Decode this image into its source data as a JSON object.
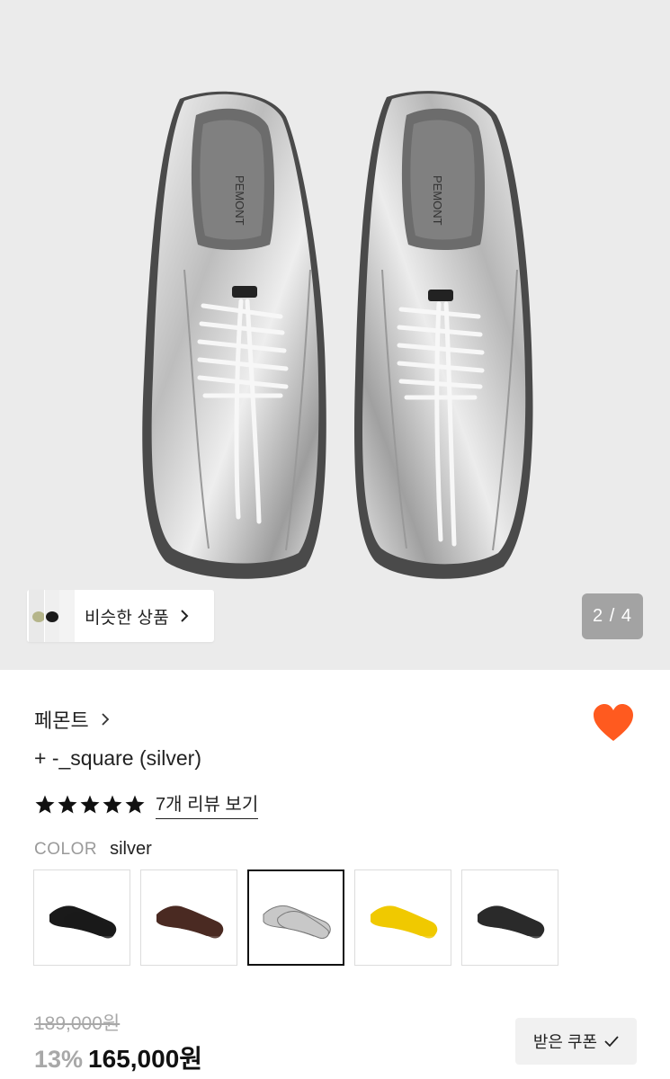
{
  "gallery": {
    "counter": "2 / 4",
    "similar_label": "비슷한 상품",
    "shoe_brand_mark": "PEMONT"
  },
  "product": {
    "brand": "페몬트",
    "name": "+ -_square (silver)",
    "rating_stars": 5,
    "review_link": "7개 리뷰 보기",
    "liked": true,
    "heart_color": "#ff5a1f"
  },
  "color": {
    "label": "COLOR",
    "value": "silver",
    "options": [
      {
        "name": "black",
        "fill": "#1a1a1a"
      },
      {
        "name": "brown",
        "fill": "#4a2a22"
      },
      {
        "name": "silver",
        "fill": "#c8c8c8",
        "selected": true
      },
      {
        "name": "yellow",
        "fill": "#f0c900"
      },
      {
        "name": "black-grey",
        "fill": "#2a2a2a"
      }
    ]
  },
  "pricing": {
    "original": "189,000원",
    "discount": "13%",
    "price": "165,000원"
  },
  "coupon": {
    "label": "받은 쿠폰"
  }
}
